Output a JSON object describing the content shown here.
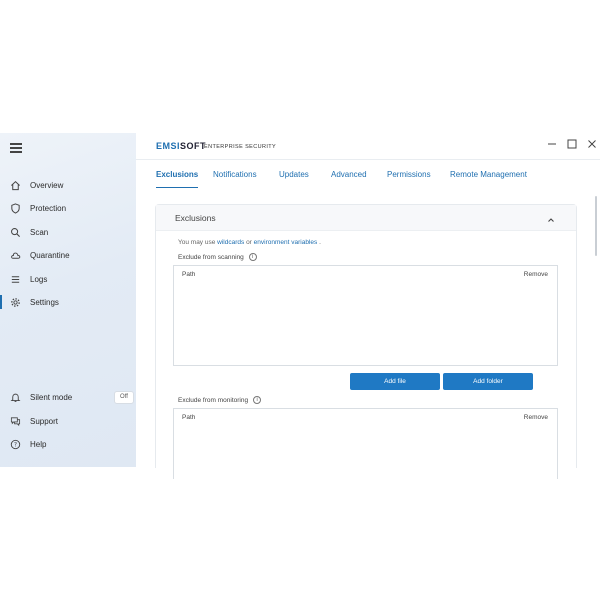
{
  "app": {
    "logo_prefix": "EMSI",
    "logo_suffix": "SOFT",
    "product": "ENTERPRISE SECURITY"
  },
  "window_controls": [
    "minimize",
    "maximize",
    "close"
  ],
  "sidebar": {
    "items": [
      {
        "label": "Overview",
        "icon": "home-icon"
      },
      {
        "label": "Protection",
        "icon": "shield-icon"
      },
      {
        "label": "Scan",
        "icon": "search-icon"
      },
      {
        "label": "Quarantine",
        "icon": "cloud-icon"
      },
      {
        "label": "Logs",
        "icon": "list-icon"
      },
      {
        "label": "Settings",
        "icon": "gear-icon",
        "active": true
      }
    ],
    "bottom": [
      {
        "label": "Silent mode",
        "icon": "bell-icon",
        "badge": "Off"
      },
      {
        "label": "Support",
        "icon": "chat-icon"
      },
      {
        "label": "Help",
        "icon": "help-icon"
      }
    ]
  },
  "tabs": [
    {
      "label": "Exclusions",
      "active": true
    },
    {
      "label": "Notifications"
    },
    {
      "label": "Updates"
    },
    {
      "label": "Advanced"
    },
    {
      "label": "Permissions"
    },
    {
      "label": "Remote Management"
    }
  ],
  "panel": {
    "title": "Exclusions",
    "hint_prefix": "You may use",
    "hint_link1": "wildcards",
    "hint_mid": "or",
    "hint_link2": "environment variables",
    "hint_suffix": ".",
    "scanning": {
      "label": "Exclude from scanning",
      "col_path": "Path",
      "col_remove": "Remove",
      "add_file": "Add file",
      "add_folder": "Add folder"
    },
    "monitoring": {
      "label": "Exclude from monitoring",
      "col_path": "Path",
      "col_remove": "Remove"
    }
  },
  "colors": {
    "accent": "#1f6fb0",
    "button": "#1f79c4",
    "sidebar_bg": "#e3ebf5"
  }
}
